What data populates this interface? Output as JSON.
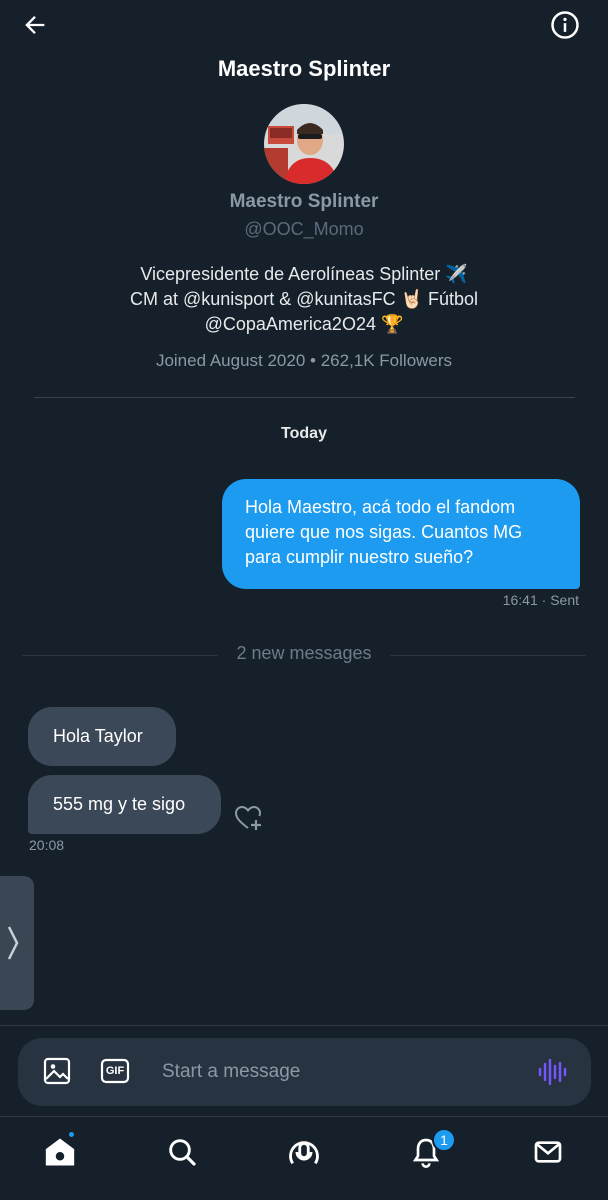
{
  "header": {
    "title": "Maestro Splinter",
    "back_icon": "arrow-left-icon",
    "info_icon": "info-icon"
  },
  "profile": {
    "name": "Maestro Splinter",
    "handle": "@OOC_Momo",
    "bio_lines": [
      "Vicepresidente de Aerolíneas Splinter ✈️",
      "CM at @kunisport & @kunitasFC 🤘🏻 Fútbol",
      "@CopaAmerica2O24 🏆"
    ],
    "meta": "Joined August 2020 • 262,1K Followers"
  },
  "conversation": {
    "day_label": "Today",
    "sent_message": {
      "text": "Hola Maestro, acá todo el fandom quiere que nos sigas. Cuantos MG para cumplir nuestro sueño?",
      "meta": "16:41 · Sent"
    },
    "new_messages_label": "2 new messages",
    "received_messages": [
      {
        "text": "Hola Taylor"
      },
      {
        "text": "555 mg y te sigo"
      }
    ],
    "received_meta": "20:08"
  },
  "composer": {
    "placeholder": "Start a message",
    "image_icon": "image-icon",
    "gif_label": "GIF",
    "voice_icon": "voice-icon"
  },
  "nav": {
    "items": [
      "home",
      "search",
      "spaces",
      "notifications",
      "messages"
    ],
    "notification_count": "1"
  },
  "colors": {
    "background": "#15202b",
    "accent": "#1d9bf0",
    "received_bubble": "#3b4857",
    "muted_text": "#8b98a5",
    "voice_accent": "#7856ff"
  }
}
